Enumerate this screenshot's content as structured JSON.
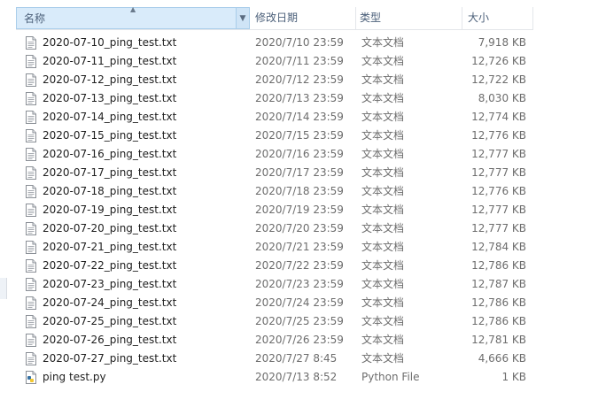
{
  "columns": {
    "name": "名称",
    "date": "修改日期",
    "type": "类型",
    "size": "大小"
  },
  "files": [
    {
      "name": "2020-07-10_ping_test.txt",
      "date": "2020/7/10 23:59",
      "type": "文本文档",
      "size": "7,918 KB",
      "icon": "text-file-icon"
    },
    {
      "name": "2020-07-11_ping_test.txt",
      "date": "2020/7/11 23:59",
      "type": "文本文档",
      "size": "12,726 KB",
      "icon": "text-file-icon"
    },
    {
      "name": "2020-07-12_ping_test.txt",
      "date": "2020/7/12 23:59",
      "type": "文本文档",
      "size": "12,722 KB",
      "icon": "text-file-icon"
    },
    {
      "name": "2020-07-13_ping_test.txt",
      "date": "2020/7/13 23:59",
      "type": "文本文档",
      "size": "8,030 KB",
      "icon": "text-file-icon"
    },
    {
      "name": "2020-07-14_ping_test.txt",
      "date": "2020/7/14 23:59",
      "type": "文本文档",
      "size": "12,774 KB",
      "icon": "text-file-icon"
    },
    {
      "name": "2020-07-15_ping_test.txt",
      "date": "2020/7/15 23:59",
      "type": "文本文档",
      "size": "12,776 KB",
      "icon": "text-file-icon"
    },
    {
      "name": "2020-07-16_ping_test.txt",
      "date": "2020/7/16 23:59",
      "type": "文本文档",
      "size": "12,777 KB",
      "icon": "text-file-icon"
    },
    {
      "name": "2020-07-17_ping_test.txt",
      "date": "2020/7/17 23:59",
      "type": "文本文档",
      "size": "12,777 KB",
      "icon": "text-file-icon"
    },
    {
      "name": "2020-07-18_ping_test.txt",
      "date": "2020/7/18 23:59",
      "type": "文本文档",
      "size": "12,776 KB",
      "icon": "text-file-icon"
    },
    {
      "name": "2020-07-19_ping_test.txt",
      "date": "2020/7/19 23:59",
      "type": "文本文档",
      "size": "12,777 KB",
      "icon": "text-file-icon"
    },
    {
      "name": "2020-07-20_ping_test.txt",
      "date": "2020/7/20 23:59",
      "type": "文本文档",
      "size": "12,777 KB",
      "icon": "text-file-icon"
    },
    {
      "name": "2020-07-21_ping_test.txt",
      "date": "2020/7/21 23:59",
      "type": "文本文档",
      "size": "12,784 KB",
      "icon": "text-file-icon"
    },
    {
      "name": "2020-07-22_ping_test.txt",
      "date": "2020/7/22 23:59",
      "type": "文本文档",
      "size": "12,786 KB",
      "icon": "text-file-icon"
    },
    {
      "name": "2020-07-23_ping_test.txt",
      "date": "2020/7/23 23:59",
      "type": "文本文档",
      "size": "12,787 KB",
      "icon": "text-file-icon"
    },
    {
      "name": "2020-07-24_ping_test.txt",
      "date": "2020/7/24 23:59",
      "type": "文本文档",
      "size": "12,786 KB",
      "icon": "text-file-icon"
    },
    {
      "name": "2020-07-25_ping_test.txt",
      "date": "2020/7/25 23:59",
      "type": "文本文档",
      "size": "12,786 KB",
      "icon": "text-file-icon"
    },
    {
      "name": "2020-07-26_ping_test.txt",
      "date": "2020/7/26 23:59",
      "type": "文本文档",
      "size": "12,781 KB",
      "icon": "text-file-icon"
    },
    {
      "name": "2020-07-27_ping_test.txt",
      "date": "2020/7/27 8:45",
      "type": "文本文档",
      "size": "4,666 KB",
      "icon": "text-file-icon"
    },
    {
      "name": "ping test.py",
      "date": "2020/7/13 8:52",
      "type": "Python File",
      "size": "1 KB",
      "icon": "python-file-icon"
    }
  ],
  "colors": {
    "header_text": "#4c607a",
    "header_active_bg": "#d9ebfa",
    "secondary_text": "#6d6d6d"
  }
}
